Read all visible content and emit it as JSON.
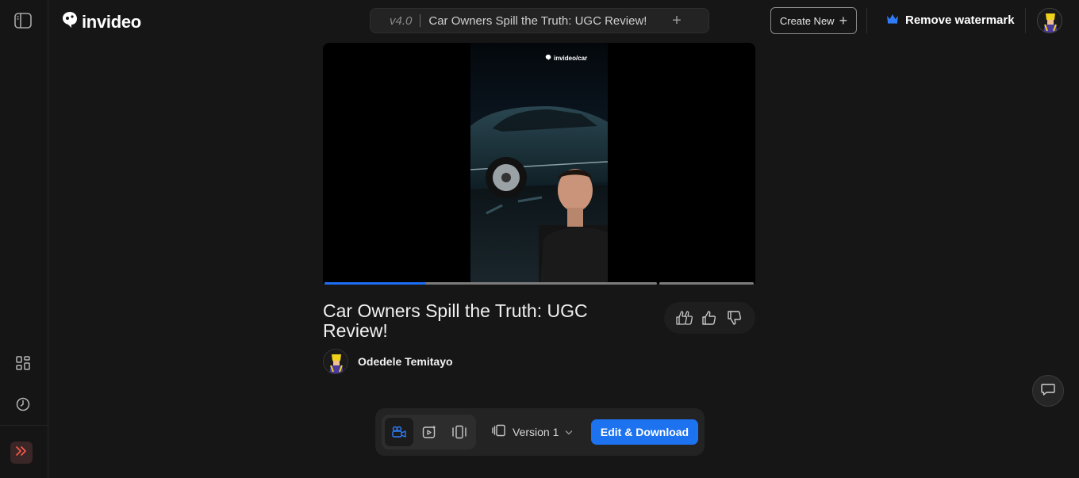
{
  "app": {
    "name": "invideo"
  },
  "header": {
    "version": "v4.0",
    "project_title": "Car Owners Spill the Truth: UGC Review!",
    "create_new_label": "Create New",
    "remove_watermark_label": "Remove watermark"
  },
  "video": {
    "watermark": "invideo/car",
    "progress_fraction": 0.31
  },
  "content": {
    "title": "Car Owners Spill the Truth: UGC Review!",
    "author": "Odedele Temitayo"
  },
  "toolbar": {
    "version_label": "Version 1",
    "edit_download_label": "Edit & Download"
  },
  "colors": {
    "accent": "#1d72f0",
    "background": "#161616"
  },
  "icons": [
    "sidebar-toggle-icon",
    "grid-icon",
    "clock-icon",
    "chevrons-right-icon",
    "crown-icon",
    "thumbs-up-double-icon",
    "thumbs-up-icon",
    "thumbs-down-icon",
    "video-camera-icon",
    "sparkle-video-icon",
    "vertical-format-icon",
    "versions-icon",
    "chevron-down-icon",
    "chat-icon"
  ]
}
